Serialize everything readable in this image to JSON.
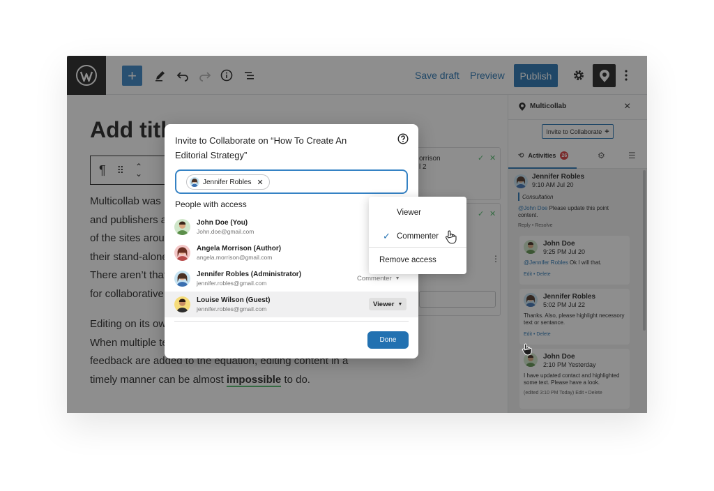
{
  "editor": {
    "toolbar": {
      "save_draft": "Save draft",
      "preview": "Preview",
      "publish": "Publish"
    },
    "title_placeholder": "Add title",
    "paragraph1": [
      "Multicollab was",
      "and publishers a",
      "of the sites arou",
      "their stand-alone",
      "There aren’t that",
      "for collaborative"
    ],
    "paragraph2": {
      "line1": "Editing on its ow",
      "line2": "When multiple te",
      "line3": "feedback are added to the equation, editing content in a",
      "line4_before": "timely manner can be almost ",
      "line4_highlight": "impossible",
      "line4_after": " to do."
    },
    "bg_cards": {
      "card1_line1": "orrison",
      "card1_line2": "l 2"
    }
  },
  "sidebar": {
    "title": "Multicollab",
    "invite_button": "Invite to Collaborate",
    "tab_activities": "Activities",
    "activities_count": "26",
    "thread": {
      "author": "Jennifer Robles",
      "time": "9:10 AM Jul 20",
      "quote": "Consultation",
      "text_mention": "@John Doe",
      "text_rest": " Please update this point content.",
      "actions": "Reply  •  Resolve"
    },
    "replies": [
      {
        "author": "John Doe",
        "time": "9:25 PM Jul 20",
        "mention": "@Jennifer Robles",
        "text": " Ok I will that.",
        "links": "Edit • Delete"
      },
      {
        "author": "Jennifer Robles",
        "time": "5:02 PM Jul 22",
        "mention": "",
        "text": "Thanks. Also, please highlight necessory text or sentance.",
        "links": "Edit • Delete"
      },
      {
        "author": "John Doe",
        "time": "2:10 PM Yesterday",
        "mention": "",
        "text": "I have updated contact and highlighted some text. Please have a look.",
        "links": "(edited 3:10 PM Today) Edit • Delete"
      }
    ]
  },
  "modal": {
    "title": "Invite to Collaborate on “How To Create An Editorial Strategy”",
    "chip_name": "Jennifer Robles",
    "access_heading": "People with access",
    "people": [
      {
        "name": "John Doe (You)",
        "email": "John.doe@gmail.com",
        "role": ""
      },
      {
        "name": "Angela Morrison (Author)",
        "email": "angela.morrison@gmail.com",
        "role": ""
      },
      {
        "name": "Jennifer Robles (Administrator)",
        "email": "jennifer.robles@gmail.com",
        "role": "Commenter"
      },
      {
        "name": "Louise Wilson (Guest)",
        "email": "jennifer.robles@gmail.com",
        "role": "Viewer"
      }
    ],
    "done": "Done"
  },
  "role_menu": {
    "options": [
      "Viewer",
      "Commenter"
    ],
    "selected": "Commenter",
    "remove": "Remove access"
  },
  "colors": {
    "accent": "#2271b1",
    "dark": "#1e1e1e",
    "highlight_underline": "#4ab866",
    "badge": "#d63638"
  }
}
